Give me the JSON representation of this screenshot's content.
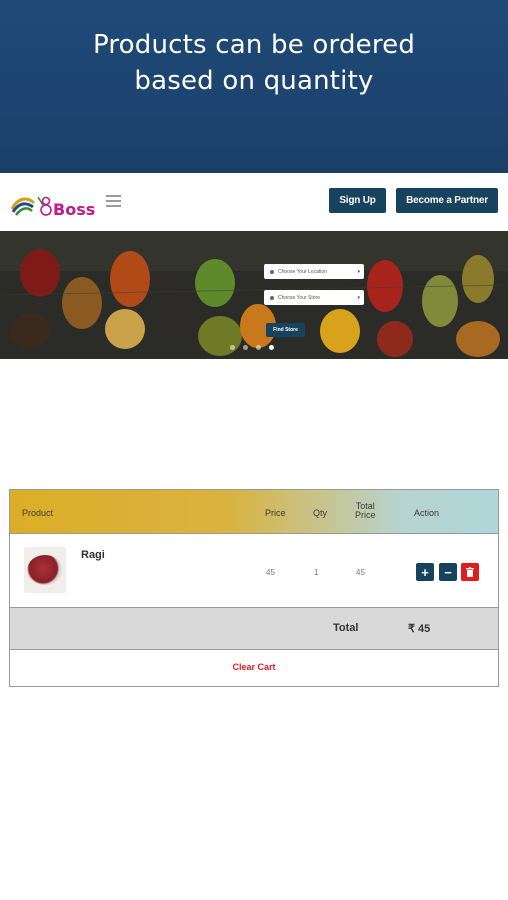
{
  "banner": {
    "line1": "Products can be ordered",
    "line2": "based on quantity"
  },
  "navbar": {
    "logo_text": "Boss",
    "signup_label": "Sign Up",
    "partner_label": "Become a Partner"
  },
  "hero": {
    "select_location_placeholder": "Choose Your Location",
    "select_store_placeholder": "Choose Your Store",
    "find_button_label": "Find Store",
    "slide_count": 4,
    "active_slide": 4
  },
  "cart": {
    "headers": {
      "product": "Product",
      "price": "Price",
      "qty": "Qty",
      "total_line1": "Total",
      "total_line2": "Price",
      "action": "Action"
    },
    "items": [
      {
        "name": "Ragi",
        "price": "45",
        "qty": "1",
        "total": "45"
      }
    ],
    "total_label": "Total",
    "total_value": "₹ 45",
    "clear_label": "Clear Cart"
  },
  "colors": {
    "banner_bg": "#1f4a78",
    "nav_button": "#17435f",
    "delete_red": "#e21b1b",
    "brand_pink": "#c2188a"
  },
  "icons": {
    "plus": "plus-icon",
    "minus": "minus-icon",
    "delete": "trash-icon",
    "menu": "hamburger-menu-icon"
  }
}
